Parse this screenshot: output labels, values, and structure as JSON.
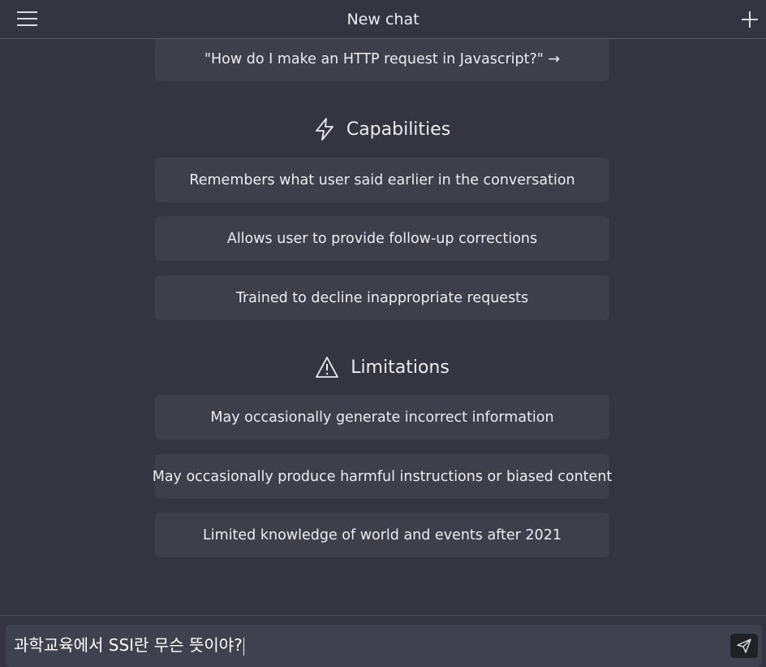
{
  "header": {
    "title": "New chat",
    "menu_icon": "hamburger-menu-icon",
    "new_chat_icon": "plus-icon"
  },
  "examples": {
    "last_example": "\"How do I make an HTTP request in Javascript?\" →"
  },
  "capabilities": {
    "heading": "Capabilities",
    "icon": "lightning-bolt-icon",
    "items": [
      "Remembers what user said earlier in the conversation",
      "Allows user to provide follow-up corrections",
      "Trained to decline inappropriate requests"
    ]
  },
  "limitations": {
    "heading": "Limitations",
    "icon": "warning-triangle-icon",
    "items": [
      "May occasionally generate incorrect information",
      "May occasionally produce harmful instructions or biased content",
      "Limited knowledge of world and events after 2021"
    ]
  },
  "composer": {
    "input_value": "과학교육에서 SSI란 무슨 뜻이야?",
    "send_icon": "paper-plane-send-icon"
  },
  "colors": {
    "background": "#343541",
    "card": "#3e3f4b",
    "input": "#40414f",
    "text": "#ececf1"
  }
}
